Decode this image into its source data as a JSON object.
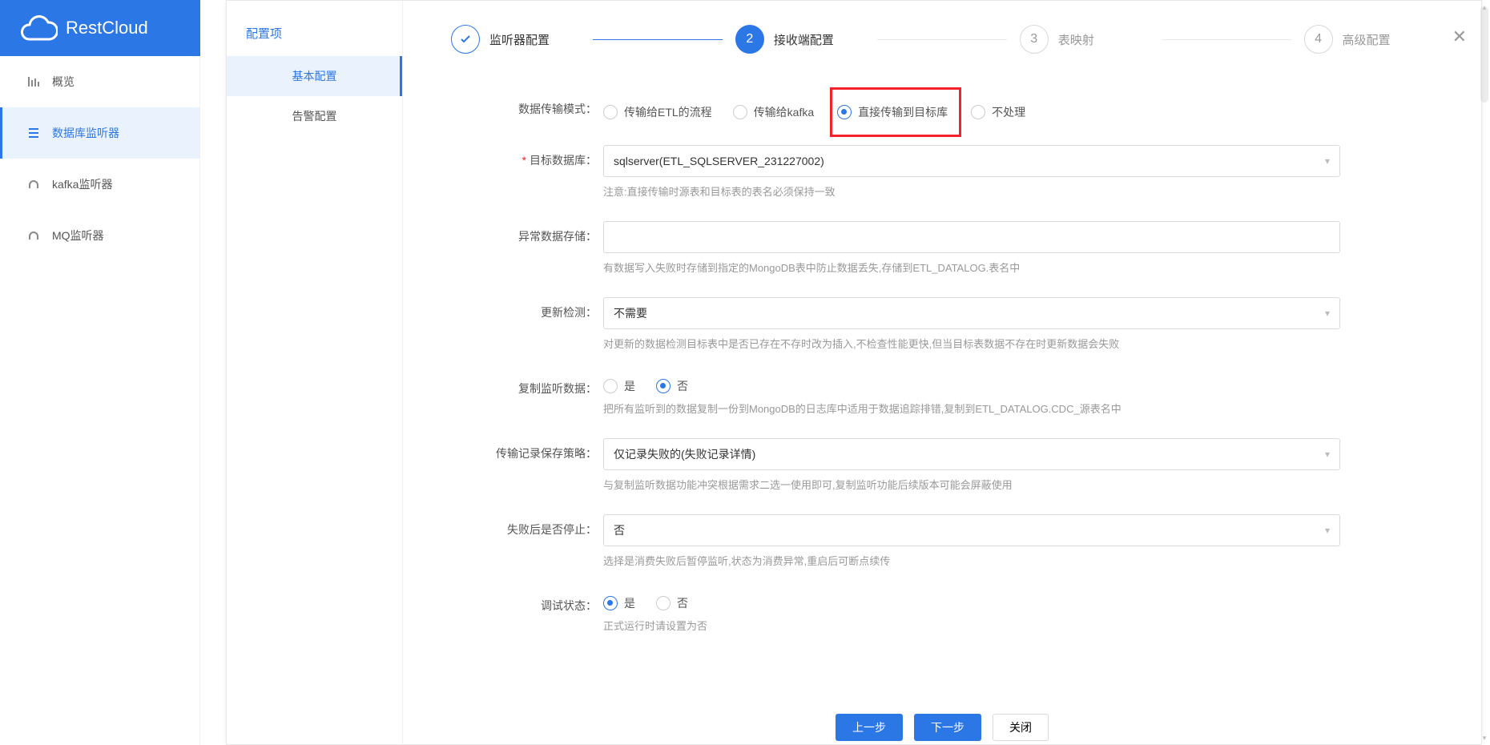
{
  "brand": "RestCloud",
  "leftNav": {
    "items": [
      {
        "label": "概览",
        "icon": "bars"
      },
      {
        "label": "数据库监听器",
        "icon": "list",
        "active": true
      },
      {
        "label": "kafka监听器",
        "icon": "headset"
      },
      {
        "label": "MQ监听器",
        "icon": "headset"
      }
    ]
  },
  "modal": {
    "sidebar_title": "配置项",
    "tabs": [
      {
        "label": "基本配置",
        "active": true
      },
      {
        "label": "告警配置"
      }
    ],
    "steps": [
      {
        "num": "",
        "title": "监听器配置",
        "state": "done"
      },
      {
        "num": "2",
        "title": "接收端配置",
        "state": "current"
      },
      {
        "num": "3",
        "title": "表映射",
        "state": "pending"
      },
      {
        "num": "4",
        "title": "高级配置",
        "state": "pending"
      }
    ],
    "form": {
      "transfer_mode": {
        "label": "数据传输模式：",
        "options": [
          {
            "label": "传输给ETL的流程",
            "checked": false
          },
          {
            "label": "传输给kafka",
            "checked": false
          },
          {
            "label": "直接传输到目标库",
            "checked": true,
            "highlight": true
          },
          {
            "label": "不处理",
            "checked": false
          }
        ]
      },
      "target_db": {
        "label": "目标数据库：",
        "required": true,
        "value": "sqlserver(ETL_SQLSERVER_231227002)",
        "help": "注意:直接传输时源表和目标表的表名必须保持一致"
      },
      "error_store": {
        "label": "异常数据存储：",
        "value": "",
        "help": "有数据写入失败时存储到指定的MongoDB表中防止数据丢失,存储到ETL_DATALOG.表名中"
      },
      "update_check": {
        "label": "更新检测：",
        "value": "不需要",
        "help": "对更新的数据检测目标表中是否已存在不存时改为插入,不检查性能更快,但当目标表数据不存在时更新数据会失败"
      },
      "copy_listen": {
        "label": "复制监听数据：",
        "options": [
          {
            "label": "是",
            "checked": false
          },
          {
            "label": "否",
            "checked": true
          }
        ],
        "help": "把所有监听到的数据复制一份到MongoDB的日志库中适用于数据追踪排错,复制到ETL_DATALOG.CDC_源表名中"
      },
      "record_policy": {
        "label": "传输记录保存策略：",
        "value": "仅记录失败的(失败记录详情)",
        "help": "与复制监听数据功能冲突根据需求二选一使用即可,复制监听功能后续版本可能会屏蔽使用"
      },
      "stop_on_fail": {
        "label": "失败后是否停止：",
        "value": "否",
        "help": "选择是消费失败后暂停监听,状态为消费异常,重启后可断点续传"
      },
      "debug_state": {
        "label": "调试状态：",
        "options": [
          {
            "label": "是",
            "checked": true
          },
          {
            "label": "否",
            "checked": false
          }
        ],
        "help": "正式运行时请设置为否"
      }
    },
    "footer": {
      "prev": "上一步",
      "next": "下一步",
      "close": "关闭"
    }
  }
}
